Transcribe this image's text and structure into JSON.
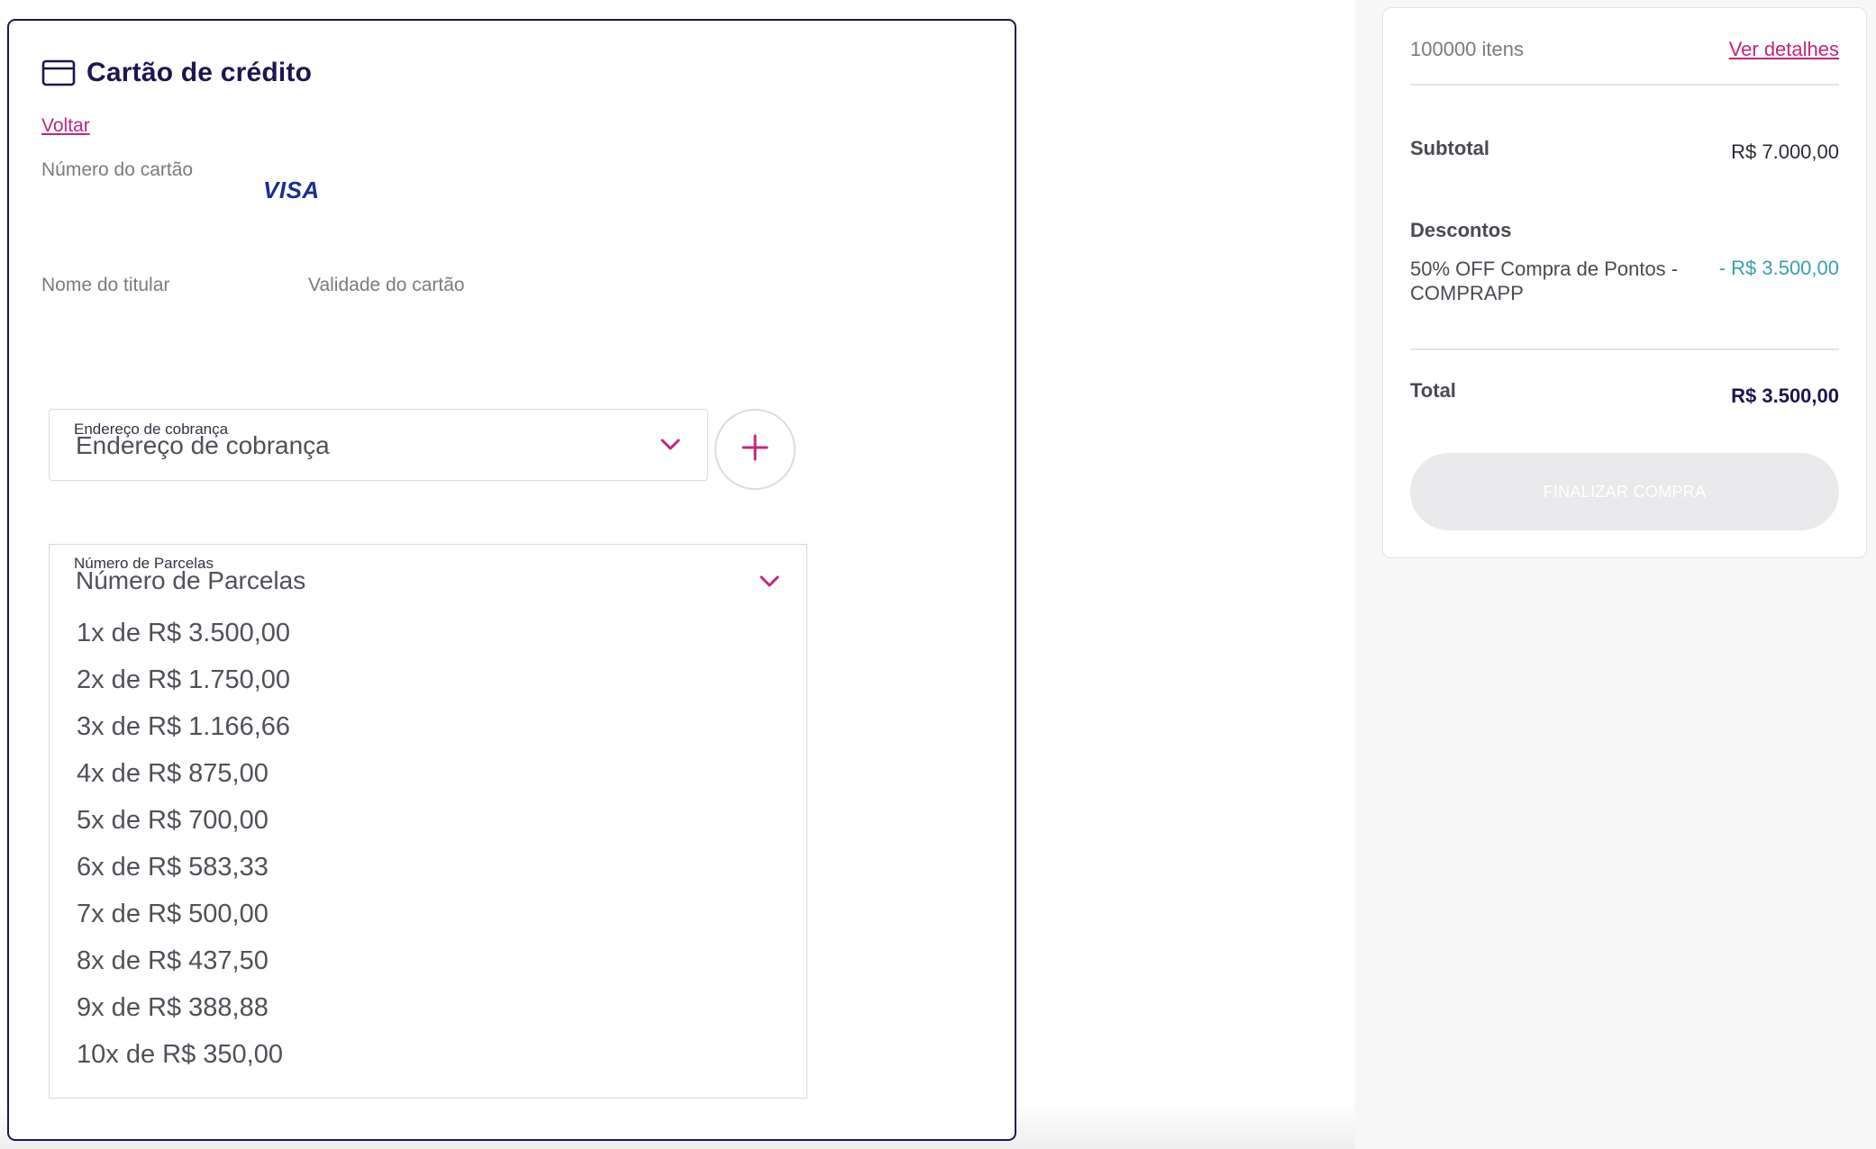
{
  "card": {
    "title": "Cartão de crédito",
    "back_link": "Voltar",
    "card_number_label": "Número do cartão",
    "brand": "VISA",
    "holder_label": "Nome do titular",
    "expiry_label": "Validade do cartão"
  },
  "billing": {
    "label": "Endereço de cobrança",
    "value": "Endereço de cobrança"
  },
  "installments": {
    "label": "Número de Parcelas",
    "value": "Número de Parcelas",
    "options": [
      "1x de R$ 3.500,00",
      "2x de R$ 1.750,00",
      "3x de R$ 1.166,66",
      "4x de R$ 875,00",
      "5x de R$ 700,00",
      "6x de R$ 583,33",
      "7x de R$ 500,00",
      "8x de R$ 437,50",
      "9x de R$ 388,88",
      "10x de R$ 350,00"
    ]
  },
  "summary": {
    "items": "100000 itens",
    "details_link": "Ver detalhes",
    "subtotal_label": "Subtotal",
    "subtotal_value": "R$ 7.000,00",
    "discounts_label": "Descontos",
    "discount_name": "50% OFF Compra de Pontos - COMPRAPP",
    "discount_value": "- R$ 3.500,00",
    "total_label": "Total",
    "total_value": "R$ 3.500,00",
    "finish_button": "FINALIZAR COMPRA"
  },
  "colors": {
    "brand_navy": "#1c1650",
    "accent_pink": "#c2257d",
    "discount_teal": "#3aa0a6",
    "disabled_button": "#e9e9eb"
  }
}
